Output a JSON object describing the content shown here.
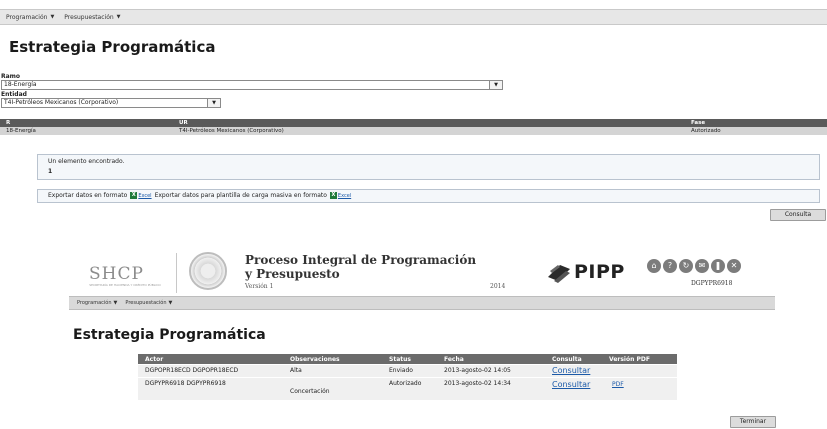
{
  "menu": {
    "items": [
      {
        "label": "Programación",
        "caret": "▼"
      },
      {
        "label": "Presupuestación",
        "caret": "▼"
      }
    ]
  },
  "page": {
    "title": "Estrategia Programática"
  },
  "form": {
    "ramo_label": "Ramo",
    "ramo_value": "18-Energía",
    "entidad_label": "Entidad",
    "entidad_value": "T4I-Petróleos Mexicanos (Corporativo)"
  },
  "results_table": {
    "headers": [
      "R",
      "UR",
      "Fase"
    ],
    "rows": [
      [
        "18-Energía",
        "T4I-Petróleos Mexicanos (Corporativo)",
        "Autorizado"
      ]
    ]
  },
  "info": {
    "found_text": "Un elemento encontrado.",
    "count": "1"
  },
  "export": {
    "text1": "Exportar datos en formato",
    "excel1": "Excel",
    "text2": "Exportar datos para plantilla de carga masiva en formato",
    "excel2": "Excel"
  },
  "buttons": {
    "consulta": "Consulta",
    "terminar": "Terminar"
  },
  "embedded": {
    "logo_text": "SHCP",
    "logo_subtext": "SECRETARÍA DE HACIENDA Y CRÉDITO PÚBLICO",
    "app_title": "Proceso Integral de Programación y Presupuesto",
    "version": "Versión 1",
    "year": "2014",
    "pipp_logo": "PIPP",
    "user": "DGPYPR6918",
    "menu": [
      {
        "label": "Programación",
        "caret": "▼"
      },
      {
        "label": "Presupuestación",
        "caret": "▼"
      }
    ],
    "title": "Estrategia Programática",
    "table": {
      "headers": [
        "Actor",
        "Observaciones",
        "Status",
        "Fecha",
        "Consulta",
        "Versión PDF"
      ],
      "rows": [
        {
          "actor": "DGPOPR18ECD DGPOPR18ECD",
          "obs": "Alta",
          "status": "Enviado",
          "fecha": "2013-agosto-02 14:05",
          "consulta": "Consultar",
          "pdf": ""
        },
        {
          "actor": "DGPYPR6918 DGPYPR6918",
          "obs": "Concertación",
          "status": "Autorizado",
          "fecha": "2013-agosto-02 14:34",
          "consulta": "Consultar",
          "pdf": "PDF"
        }
      ]
    },
    "icons": [
      "home-icon",
      "help-icon",
      "refresh-icon",
      "mail-icon",
      "book-icon",
      "close-icon"
    ]
  }
}
